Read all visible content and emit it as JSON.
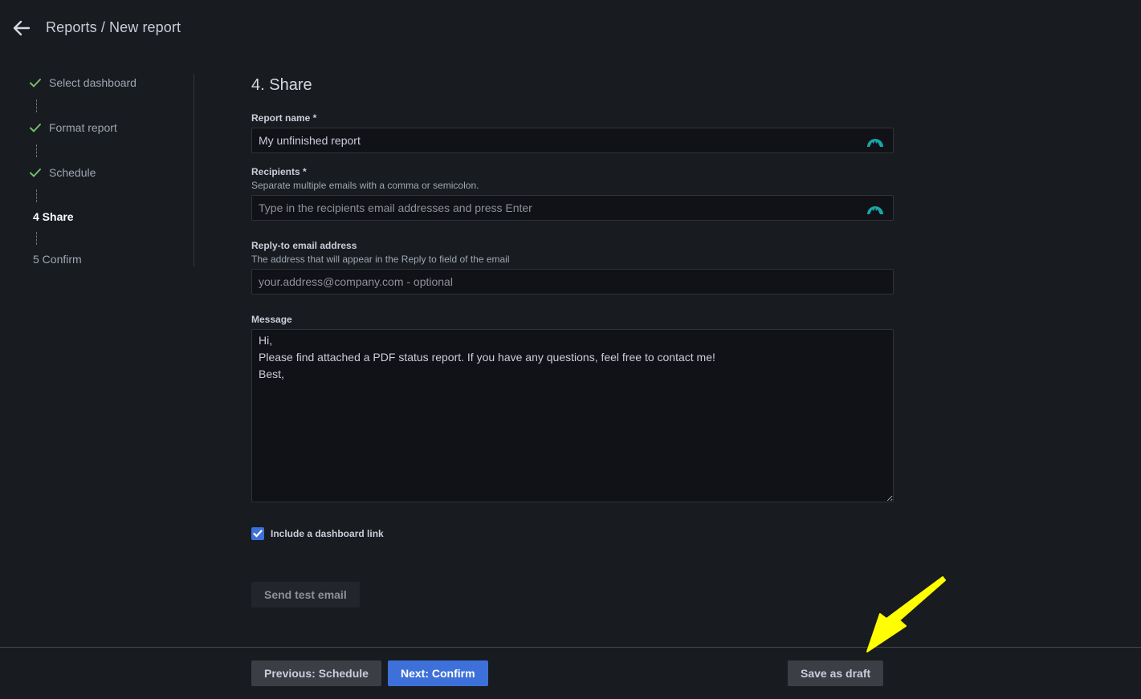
{
  "header": {
    "back_icon": "arrow-left-icon",
    "breadcrumb": "Reports / New report"
  },
  "stepper": {
    "steps": [
      {
        "label": "Select dashboard",
        "state": "done",
        "icon": "check-icon"
      },
      {
        "label": "Format report",
        "state": "done",
        "icon": "check-icon"
      },
      {
        "label": "Schedule",
        "state": "done",
        "icon": "check-icon"
      },
      {
        "label": "4 Share",
        "state": "active"
      },
      {
        "label": "5 Confirm",
        "state": "pending"
      }
    ]
  },
  "form": {
    "title": "4. Share",
    "report_name": {
      "label": "Report name *",
      "value": "My unfinished report",
      "icon": "password-manager-icon"
    },
    "recipients": {
      "label": "Recipients *",
      "description": "Separate multiple emails with a comma or semicolon.",
      "placeholder": "Type in the recipients email addresses and press Enter",
      "value": "",
      "icon": "password-manager-icon"
    },
    "reply_to": {
      "label": "Reply-to email address",
      "description": "The address that will appear in the Reply to field of the email",
      "placeholder": "your.address@company.com - optional",
      "value": ""
    },
    "message": {
      "label": "Message",
      "value": "Hi,\nPlease find attached a PDF status report. If you have any questions, feel free to contact me!\nBest,"
    },
    "include_dashboard_link": {
      "label": "Include a dashboard link",
      "checked": true
    },
    "send_test_email_label": "Send test email"
  },
  "footer": {
    "previous_label": "Previous: Schedule",
    "next_label": "Next: Confirm",
    "save_draft_label": "Save as draft"
  },
  "colors": {
    "background": "#181b1f",
    "primary": "#3d71d9",
    "success": "#73bf69",
    "annotation": "#ffff00",
    "icon_teal": "#1aa5a5"
  }
}
